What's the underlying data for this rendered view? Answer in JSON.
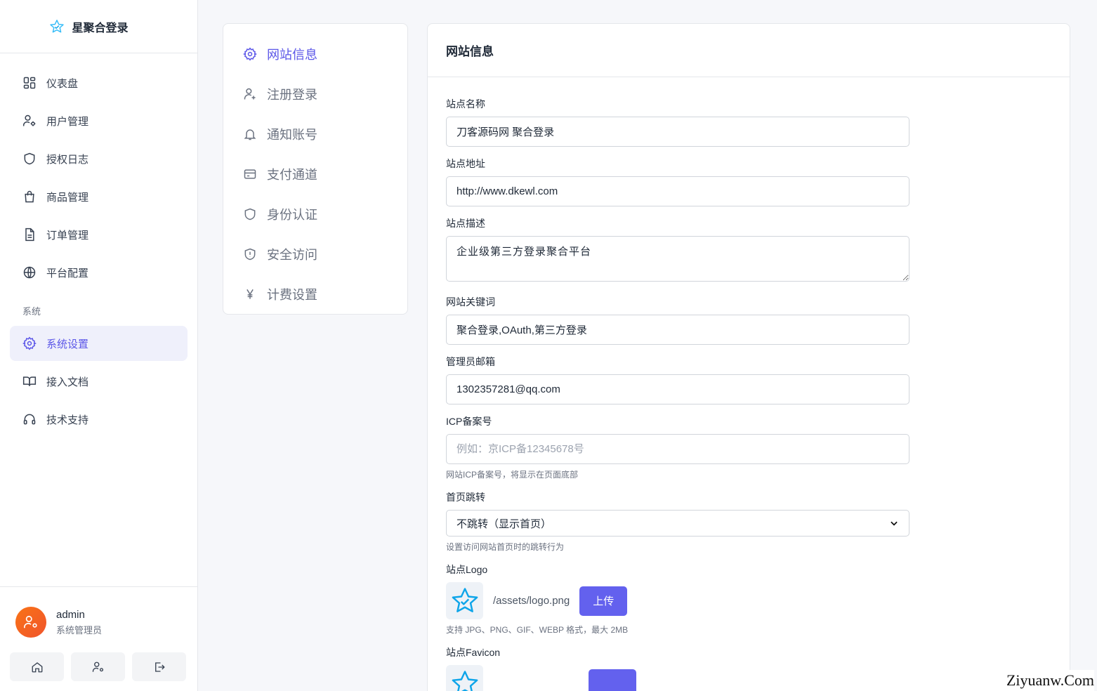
{
  "brand": {
    "name": "星聚合登录",
    "icon": "star-shield-logo"
  },
  "sidebar": {
    "items": [
      {
        "label": "仪表盘",
        "icon": "dashboard-icon"
      },
      {
        "label": "用户管理",
        "icon": "user-gear-icon"
      },
      {
        "label": "授权日志",
        "icon": "shield-icon"
      },
      {
        "label": "商品管理",
        "icon": "shopping-bag-icon"
      },
      {
        "label": "订单管理",
        "icon": "document-icon"
      },
      {
        "label": "平台配置",
        "icon": "globe-icon"
      }
    ],
    "group_label": "系统",
    "system_items": [
      {
        "label": "系统设置",
        "icon": "gear-icon",
        "active": true
      },
      {
        "label": "接入文档",
        "icon": "book-icon"
      },
      {
        "label": "技术支持",
        "icon": "headset-icon"
      }
    ]
  },
  "user": {
    "name": "admin",
    "role": "系统管理员"
  },
  "settings_menu": [
    {
      "label": "网站信息",
      "icon": "gear-icon",
      "active": true
    },
    {
      "label": "注册登录",
      "icon": "user-plus-icon"
    },
    {
      "label": "通知账号",
      "icon": "bell-icon"
    },
    {
      "label": "支付通道",
      "icon": "credit-card-icon"
    },
    {
      "label": "身份认证",
      "icon": "shield-icon"
    },
    {
      "label": "安全访问",
      "icon": "shield-alert-icon"
    },
    {
      "label": "计费设置",
      "icon": "yen-icon"
    }
  ],
  "panel": {
    "title": "网站信息",
    "site_name": {
      "label": "站点名称",
      "value": "刀客源码网 聚合登录"
    },
    "site_url": {
      "label": "站点地址",
      "value": "http://www.dkewl.com"
    },
    "site_desc": {
      "label": "站点描述",
      "value": "企业级第三方登录聚合平台"
    },
    "keywords": {
      "label": "网站关键词",
      "value": "聚合登录,OAuth,第三方登录"
    },
    "admin_email": {
      "label": "管理员邮箱",
      "value": "1302357281@qq.com"
    },
    "icp": {
      "label": "ICP备案号",
      "placeholder": "例如：京ICP备12345678号",
      "hint": "网站ICP备案号，将显示在页面底部"
    },
    "redirect": {
      "label": "首页跳转",
      "value": "不跳转（显示首页）",
      "hint": "设置访问网站首页时的跳转行为"
    },
    "logo": {
      "label": "站点Logo",
      "path": "/assets/logo.png",
      "upload_label": "上传",
      "hint": "支持 JPG、PNG、GIF、WEBP 格式，最大 2MB"
    },
    "favicon": {
      "label": "站点Favicon"
    }
  },
  "watermark": "Ziyuanw.Com",
  "colors": {
    "accent": "#5b56e8",
    "button": "#6361ee",
    "avatar": "#f97316"
  }
}
